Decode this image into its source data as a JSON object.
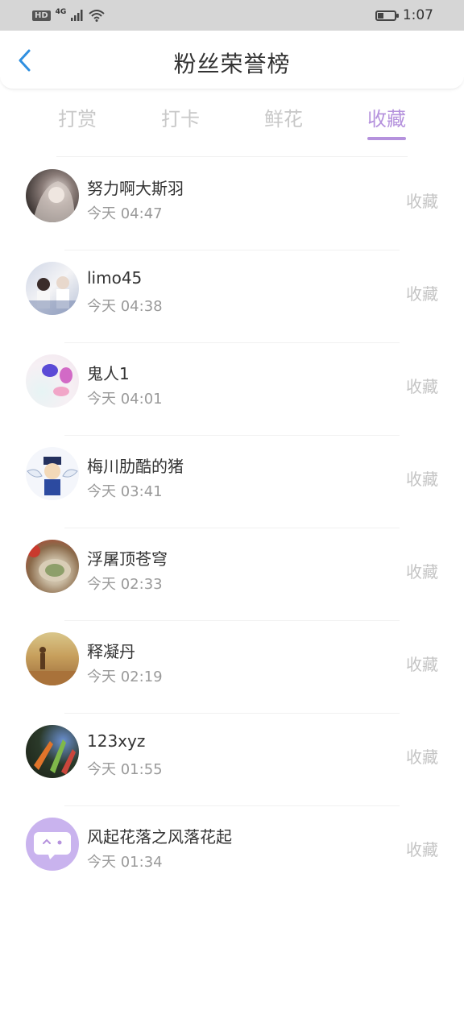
{
  "status_bar": {
    "network": "4G",
    "hd": "HD",
    "time": "1:07",
    "battery_level": 0.35
  },
  "header": {
    "title": "粉丝荣誉榜"
  },
  "tabs": [
    {
      "label": "打赏",
      "active": false
    },
    {
      "label": "打卡",
      "active": false
    },
    {
      "label": "鲜花",
      "active": false
    },
    {
      "label": "收藏",
      "active": true
    }
  ],
  "fans": [
    {
      "name": "努力啊大斯羽",
      "time": "今天 04:47",
      "action": "收藏"
    },
    {
      "name": "limo45",
      "time": "今天 04:38",
      "action": "收藏"
    },
    {
      "name": "鬼人1",
      "time": "今天 04:01",
      "action": "收藏"
    },
    {
      "name": "梅川肋酷的猪",
      "time": "今天 03:41",
      "action": "收藏"
    },
    {
      "name": "浮屠顶苍穹",
      "time": "今天 02:33",
      "action": "收藏"
    },
    {
      "name": "释凝丹",
      "time": "今天 02:19",
      "action": "收藏"
    },
    {
      "name": "123xyz",
      "time": "今天 01:55",
      "action": "收藏"
    },
    {
      "name": "风起花落之风落花起",
      "time": "今天 01:34",
      "action": "收藏"
    }
  ],
  "colors": {
    "accent": "#b592dd",
    "back_arrow": "#2f8fe0"
  }
}
